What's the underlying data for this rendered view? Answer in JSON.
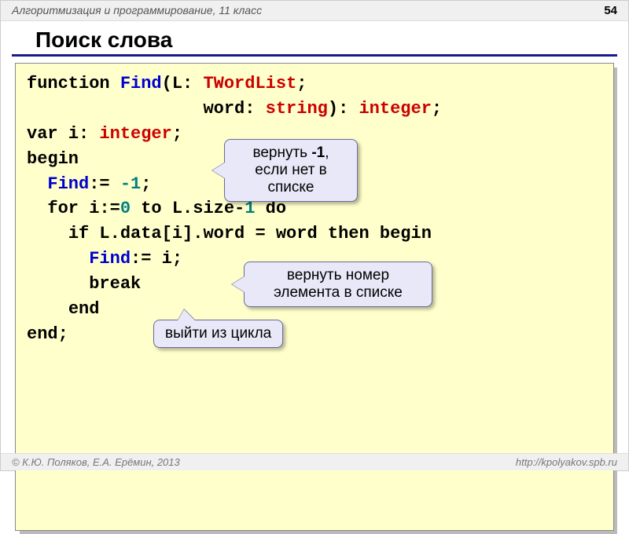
{
  "header": {
    "course": "Алгоритмизация и программирование, 11 класс",
    "page": "54"
  },
  "title": "Поиск слова",
  "code": {
    "l1": {
      "kw_function": "function",
      "find": "Find",
      "open": "(L:",
      "twordlist": "TWordList",
      "semi": ";"
    },
    "l2": {
      "pad": "                 ",
      "word": "word:",
      "string": "string",
      "close": "):",
      "integer": "integer",
      "semi": ";"
    },
    "l3": {
      "kw_var": "var",
      "i": "i:",
      "integer": "integer",
      "semi": ";"
    },
    "l4": {
      "kw_begin": "begin"
    },
    "l5": {
      "pad": "  ",
      "find": "Find",
      "assign": ":= ",
      "neg1": "-1",
      "semi": ";"
    },
    "l6": {
      "pad": "  ",
      "kw_for": "for",
      "i_assign": "i:=",
      "zero": "0",
      "kw_to": "to",
      "lsize": "L.size-",
      "one": "1",
      "kw_do": "do"
    },
    "l7": {
      "pad": "    ",
      "kw_if": "if",
      "cond": "L.data[i].word = word",
      "kw_then": "then begin"
    },
    "l8": {
      "pad": "      ",
      "find": "Find",
      "assign": ":= i;"
    },
    "l9": {
      "pad": "      ",
      "kw_break": "break"
    },
    "l10": {
      "pad": "    ",
      "kw_end": "end"
    },
    "l11": {
      "kw_end": "end",
      "semi": ";"
    }
  },
  "callouts": {
    "c1_a": "вернуть ",
    "c1_b": "-1",
    "c1_c": ",",
    "c1_d": "если нет в списке",
    "c2": "вернуть номер элемента в списке",
    "c3": "выйти из цикла"
  },
  "footer": {
    "left": "© К.Ю. Поляков, Е.А. Ерёмин, 2013",
    "right": "http://kpolyakov.spb.ru"
  }
}
